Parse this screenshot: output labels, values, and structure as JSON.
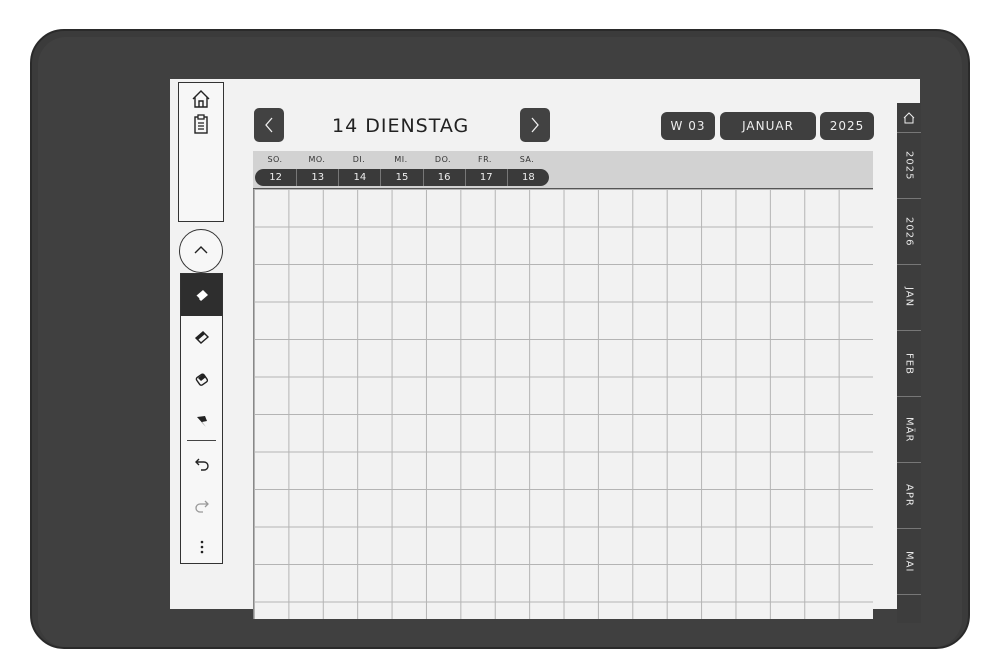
{
  "header": {
    "day_title": "14 DIENSTAG",
    "week": "W 03",
    "month": "JANUAR",
    "year": "2025"
  },
  "week_strip": {
    "days": [
      {
        "label": "SO.",
        "num": "12"
      },
      {
        "label": "MO.",
        "num": "13"
      },
      {
        "label": "DI.",
        "num": "14"
      },
      {
        "label": "MI.",
        "num": "15"
      },
      {
        "label": "DO.",
        "num": "16"
      },
      {
        "label": "FR.",
        "num": "17"
      },
      {
        "label": "SA.",
        "num": "18"
      }
    ]
  },
  "right_tabs": [
    "2025",
    "2026",
    "JAN",
    "FEB",
    "MÄR",
    "APR",
    "MAI"
  ],
  "icons": {
    "home": "home-icon",
    "notes": "clipboard-icon",
    "collapse": "chevron-up-icon",
    "tools": [
      "highlighter-icon",
      "marker-icon",
      "eraser-icon",
      "lasso-icon",
      "undo-icon",
      "redo-icon",
      "more-icon"
    ]
  },
  "colors": {
    "device": "#3b3b3b",
    "screen": "#f2f2f2",
    "accent": "#424242"
  }
}
